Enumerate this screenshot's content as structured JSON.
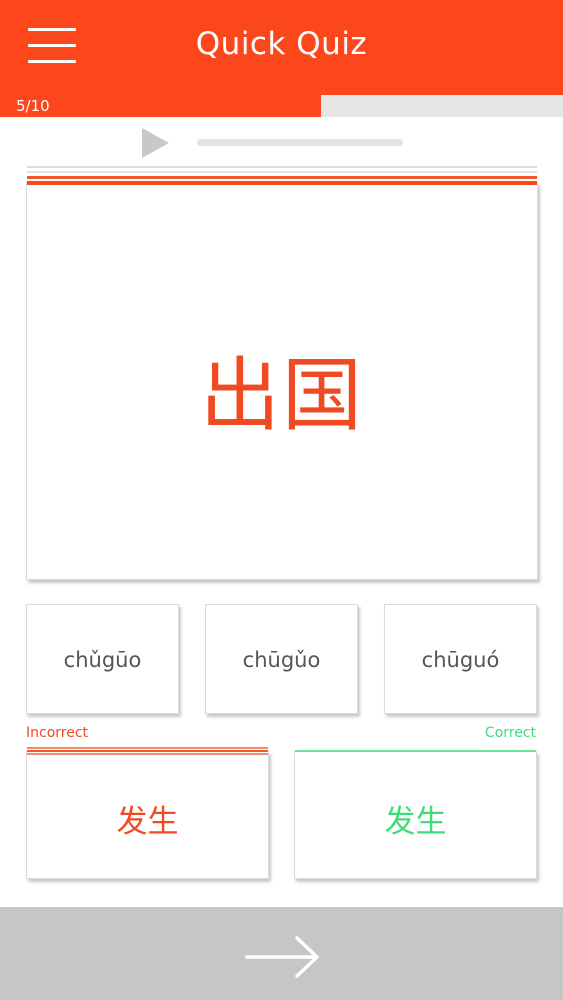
{
  "header": {
    "title": "Quick Quiz",
    "menu_icon": "hamburger-menu-icon",
    "background": "#fb471b"
  },
  "progress": {
    "text": "5/10",
    "current": 5,
    "total": 10,
    "fraction": 0.57
  },
  "audio": {
    "play_icon": "play-icon",
    "position_fraction": 0.0
  },
  "question": {
    "characters": "出国",
    "color": "#f04a22"
  },
  "options": [
    {
      "text": "chǔgūo"
    },
    {
      "text": "chūgǔo"
    },
    {
      "text": "chūguó"
    }
  ],
  "feedback": {
    "incorrect": {
      "label": "Incorrect",
      "answer": "发生",
      "color": "#f04a22"
    },
    "correct": {
      "label": "Correct",
      "answer": "发生",
      "color": "#3fdd7a"
    }
  },
  "next": {
    "icon": "arrow-right-icon",
    "background": "#c6c6c6"
  }
}
